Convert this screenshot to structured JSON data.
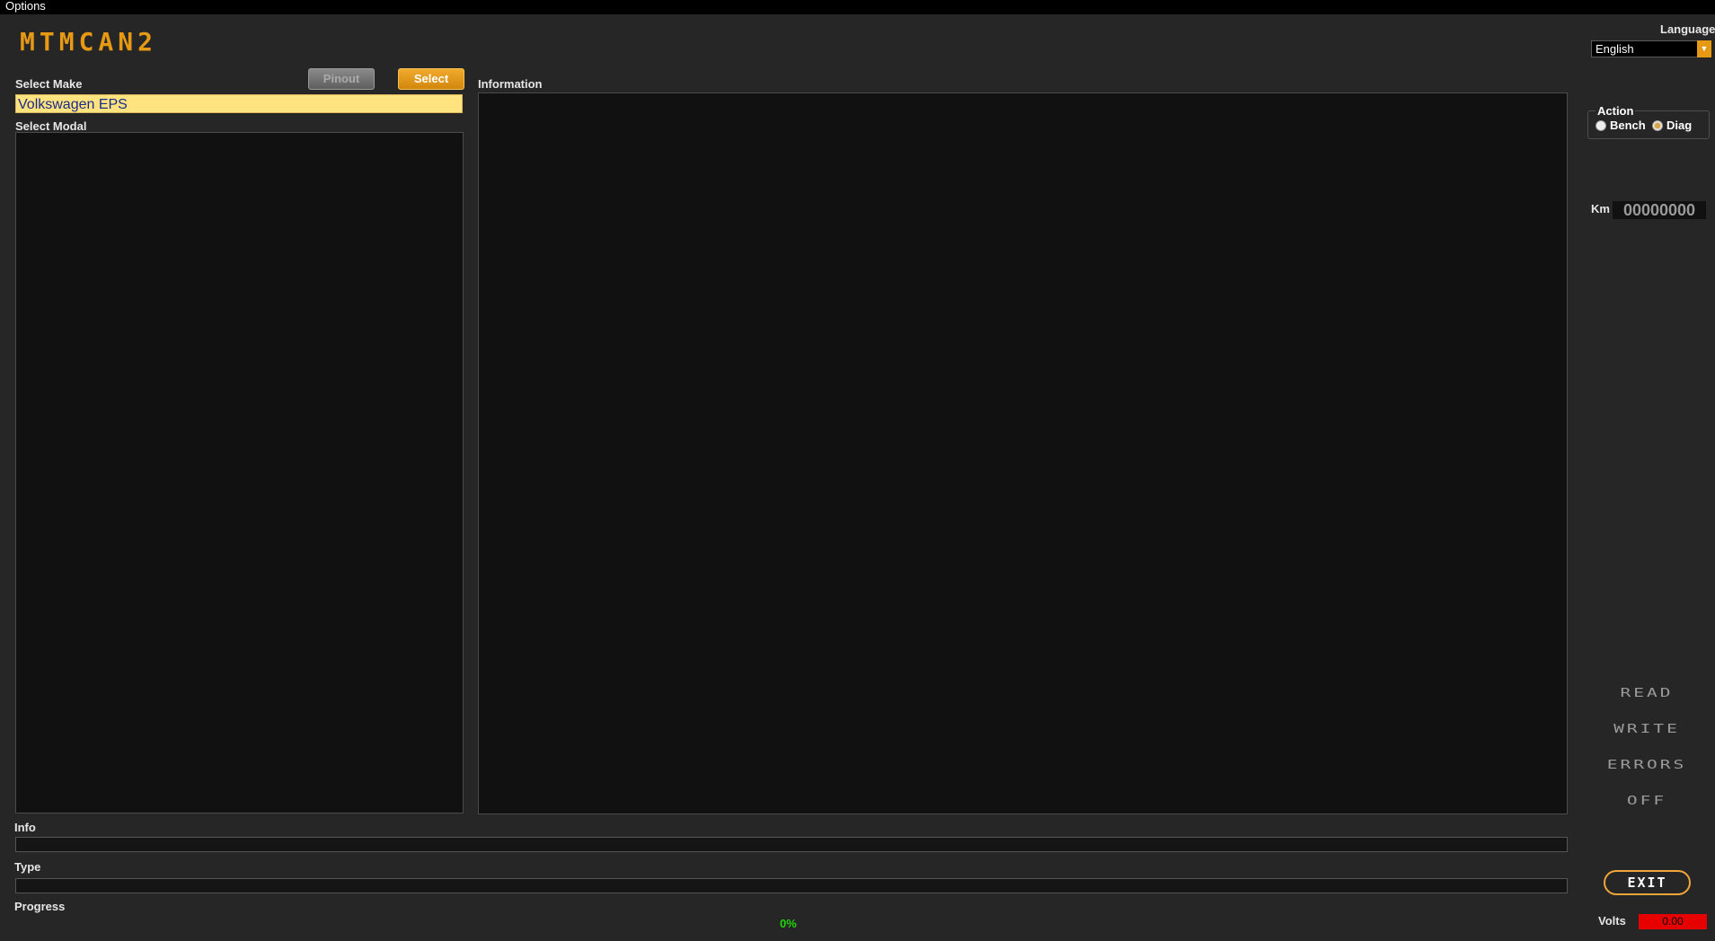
{
  "menu": {
    "options": "Options"
  },
  "logo": "MTMCAN2",
  "make": {
    "label": "Select Make",
    "pinout": "Pinout",
    "select": "Select",
    "value": "Volkswagen EPS"
  },
  "modal": {
    "label": "Select Modal"
  },
  "information": {
    "label": "Information"
  },
  "info": {
    "label": "Info"
  },
  "type": {
    "label": "Type"
  },
  "progress": {
    "label": "Progress",
    "value": "0%",
    "fraction": 0
  },
  "language": {
    "label": "Language",
    "selected": "English"
  },
  "action": {
    "label": "Action",
    "bench": "Bench",
    "diag": "Diag",
    "selected": "Diag"
  },
  "km": {
    "label": "Km",
    "value": "00000000"
  },
  "buttons": {
    "read": "READ",
    "write": "WRITE",
    "errors": "ERRORS",
    "off": "OFF",
    "exit": "EXIT"
  },
  "volts": {
    "label": "Volts",
    "value": "0.00"
  },
  "colors": {
    "accent": "#e69a14",
    "background": "#262626",
    "make_highlight": "#ffe37f",
    "progress_text": "#22d40b",
    "volts_bg": "#e60000"
  }
}
